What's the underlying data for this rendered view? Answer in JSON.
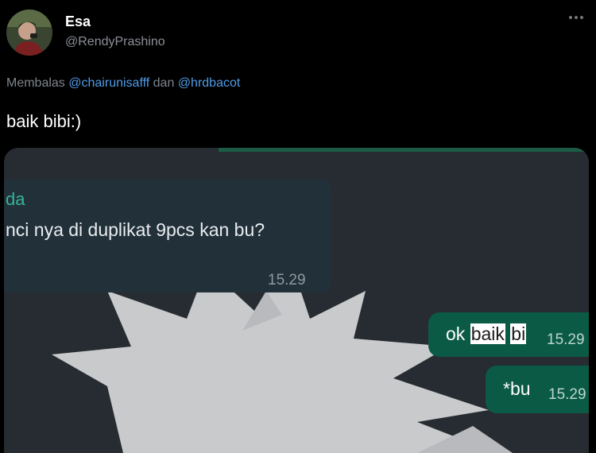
{
  "author": {
    "display_name": "Esa",
    "handle": "@RendyPrashino"
  },
  "reply": {
    "prefix": "Membalas",
    "mention_1": "@chairunisafff",
    "joiner": "dan",
    "mention_2": "@hrdbacot"
  },
  "tweet": {
    "text": "baik bibi:)"
  },
  "chat": {
    "incoming": {
      "sender": "da",
      "text": "nci nya di duplikat 9pcs kan bu?",
      "time": "15.29"
    },
    "outgoing": [
      {
        "prefix": "ok",
        "highlight_1": "baik",
        "highlight_2": "bi",
        "time": "15.29"
      },
      {
        "text": "*bu",
        "time": "15.29"
      }
    ]
  },
  "colors": {
    "background": "#000000",
    "mention": "#4f9be6",
    "chat_background": "#262c31",
    "incoming_bubble": "#22303a",
    "outgoing_bubble": "#0b5a45",
    "sender_name": "#35b59a"
  },
  "icons": {
    "more": "more-horizontal-icon"
  }
}
